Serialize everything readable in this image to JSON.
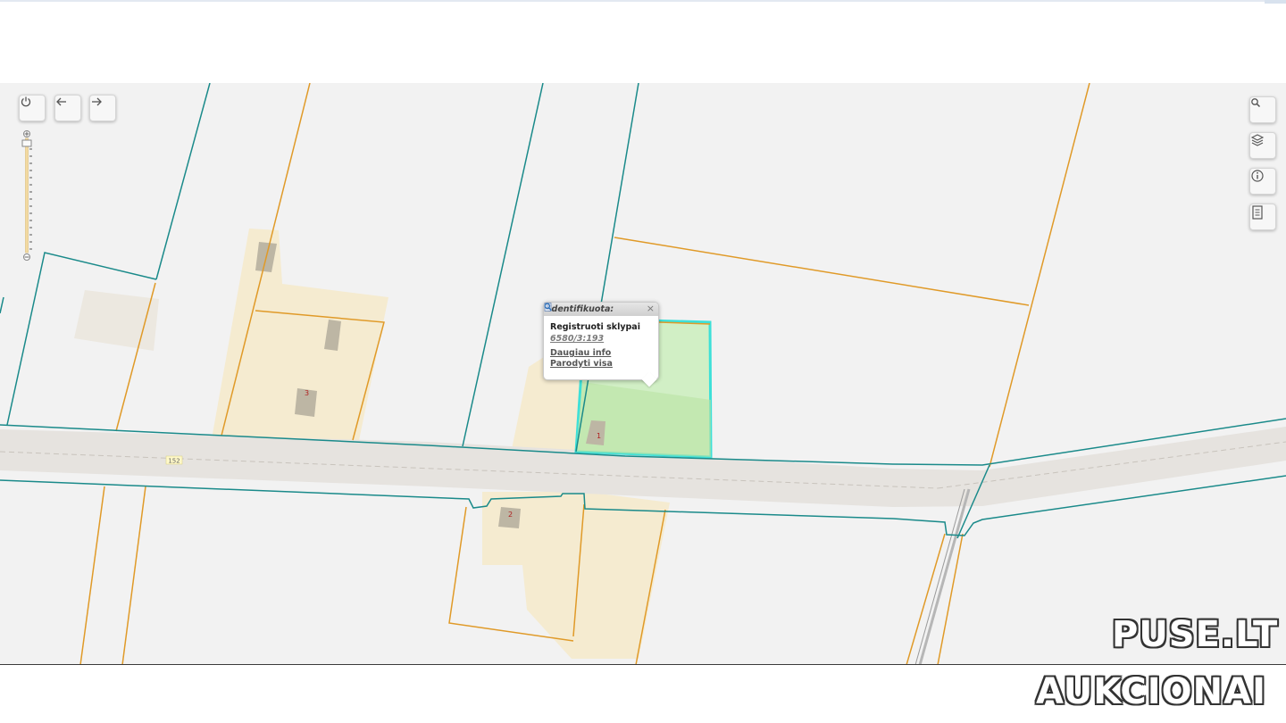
{
  "map": {
    "road_label": "152",
    "building_numbers": [
      "3",
      "1",
      "2"
    ]
  },
  "controls": {
    "left": [
      {
        "name": "power-icon"
      },
      {
        "name": "back-arrow-icon"
      },
      {
        "name": "forward-arrow-icon"
      }
    ],
    "right": [
      {
        "name": "search-icon"
      },
      {
        "name": "layers-icon"
      },
      {
        "name": "info-icon"
      },
      {
        "name": "document-icon"
      }
    ]
  },
  "popup": {
    "title": "Identifikuota:",
    "close": "×",
    "layer_name": "Registruoti sklypai",
    "parcel_id": "6580/3:193",
    "more_info": "Daugiau info",
    "show_all": "Parodyti visa"
  },
  "watermark": {
    "line1": "PUSE.LT",
    "line2": "AUKCIONAI"
  },
  "colors": {
    "background": "#f2f2f2",
    "parcel_boundary": "#1a8a8a",
    "cadastral_boundary": "#e09a28",
    "yard_fill": "#f5ebd0",
    "building": "#bdb6a4",
    "selected_parcel": "#3de0d8",
    "selected_fill": "#cdeec0",
    "road": "#e6e3df"
  }
}
